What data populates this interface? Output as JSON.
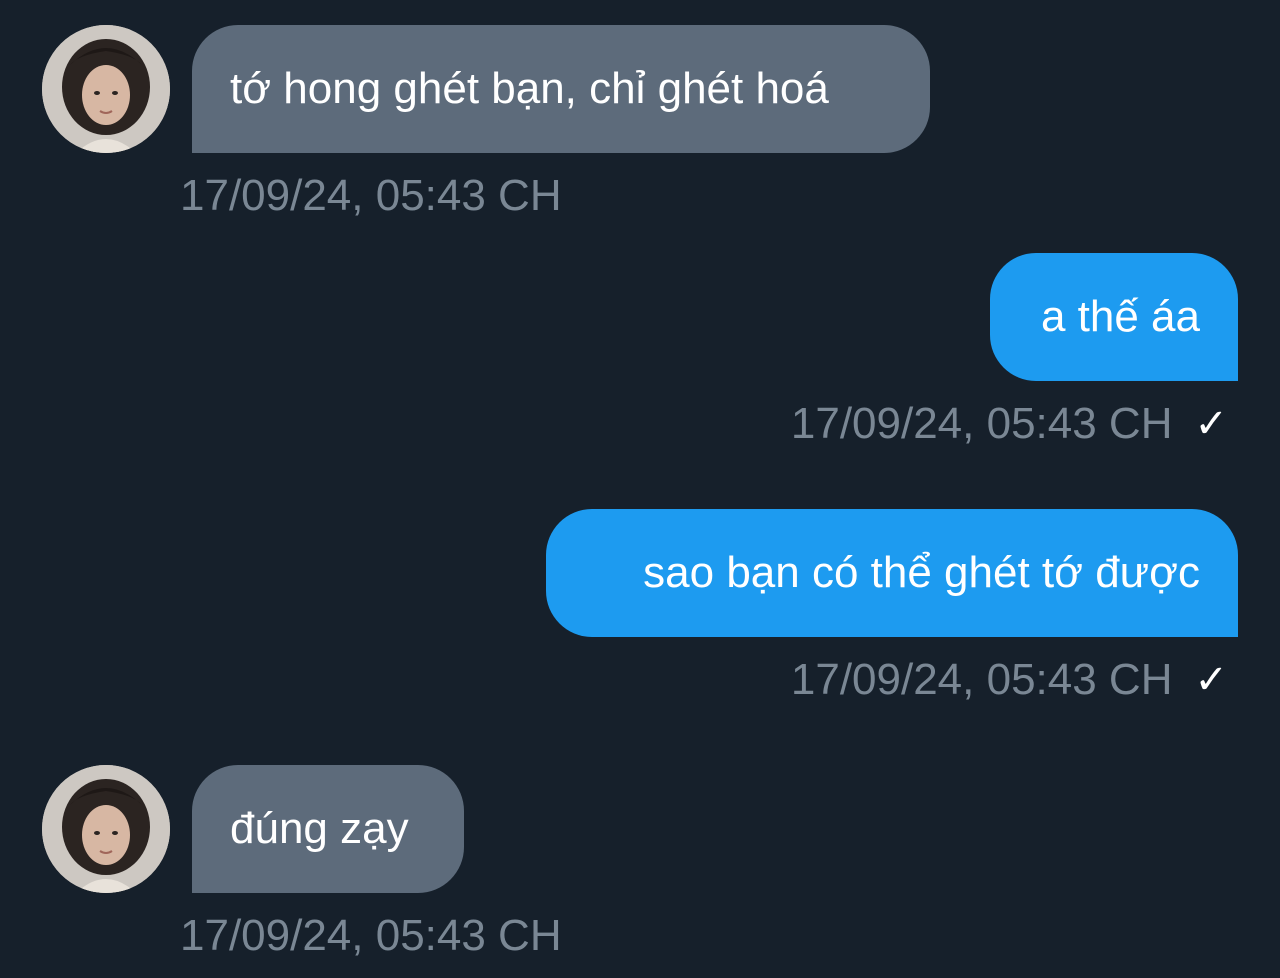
{
  "colors": {
    "background": "#16202b",
    "incoming_bubble": "#5d6b7b",
    "outgoing_bubble": "#1d9bf0",
    "timestamp": "#7a8794"
  },
  "messages": [
    {
      "direction": "incoming",
      "text": "tớ hong ghét bạn, chỉ ghét hoá",
      "time": "17/09/24, 05:43 CH",
      "has_avatar": true
    },
    {
      "direction": "outgoing",
      "text": "a thế áa",
      "time": "17/09/24, 05:43 CH",
      "status_icon": "✓"
    },
    {
      "direction": "outgoing",
      "text": "sao bạn có thể ghét tớ được",
      "time": "17/09/24, 05:43 CH",
      "status_icon": "✓"
    },
    {
      "direction": "incoming",
      "text": "đúng zạy",
      "time": "17/09/24, 05:43 CH",
      "has_avatar": true
    }
  ]
}
